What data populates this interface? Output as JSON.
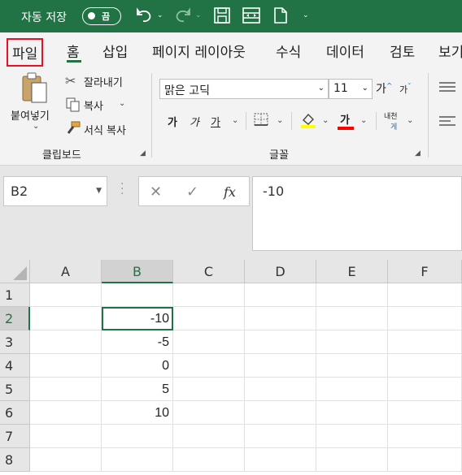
{
  "titlebar": {
    "autosave_label": "자동 저장",
    "autosave_state": "끔"
  },
  "tabs": [
    "파일",
    "홈",
    "삽입",
    "페이지 레이아웃",
    "수식",
    "데이터",
    "검토",
    "보기"
  ],
  "ribbon": {
    "paste_label": "붙여넣기",
    "cut_label": "잘라내기",
    "copy_label": "복사",
    "format_painter_label": "서식 복사",
    "clipboard_group": "클립보드",
    "font_name": "맑은 고딕",
    "font_size": "11",
    "grow_font": "가",
    "shrink_font": "가",
    "bold": "가",
    "italic": "가",
    "underline": "가",
    "font_color_glyph": "가",
    "phonetic_top": "내천",
    "phonetic_bottom": "게",
    "font_group": "글꼴",
    "colors": {
      "highlight": "#ffff00",
      "font_color": "#ff0000"
    }
  },
  "formula_bar": {
    "name_box": "B2",
    "cancel": "✕",
    "enter": "✓",
    "fx": "fx",
    "content": "-10"
  },
  "sheet": {
    "columns": [
      "A",
      "B",
      "C",
      "D",
      "E",
      "F"
    ],
    "rows": [
      "1",
      "2",
      "3",
      "4",
      "5",
      "6",
      "7",
      "8"
    ],
    "b_values": [
      "",
      "-10",
      "-5",
      "0",
      "5",
      "10",
      "",
      ""
    ],
    "active_cell": "B2"
  },
  "theme": {
    "accent": "#217346",
    "file_highlight": "#e81123"
  }
}
